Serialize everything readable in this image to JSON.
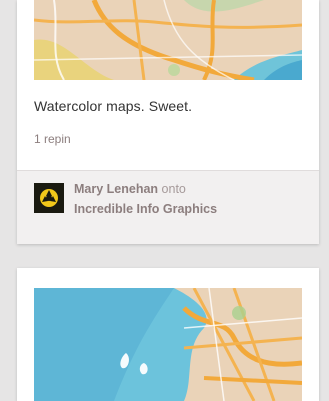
{
  "pins": [
    {
      "description": "Watercolor maps. Sweet.",
      "repins": "1 repin",
      "pinner": "Mary Lenehan",
      "onto_word": "onto",
      "board": "Incredible Info Graphics"
    }
  ],
  "colors": {
    "background": "#e6e5e5",
    "card": "#ffffff",
    "attribution_bg": "#f2f0f0",
    "avatar_bg": "#1a1a10",
    "avatar_icon": "#f2c81a",
    "meta_text": "#8c7e7e"
  },
  "icons": {
    "avatar": "record-adapter-icon"
  }
}
